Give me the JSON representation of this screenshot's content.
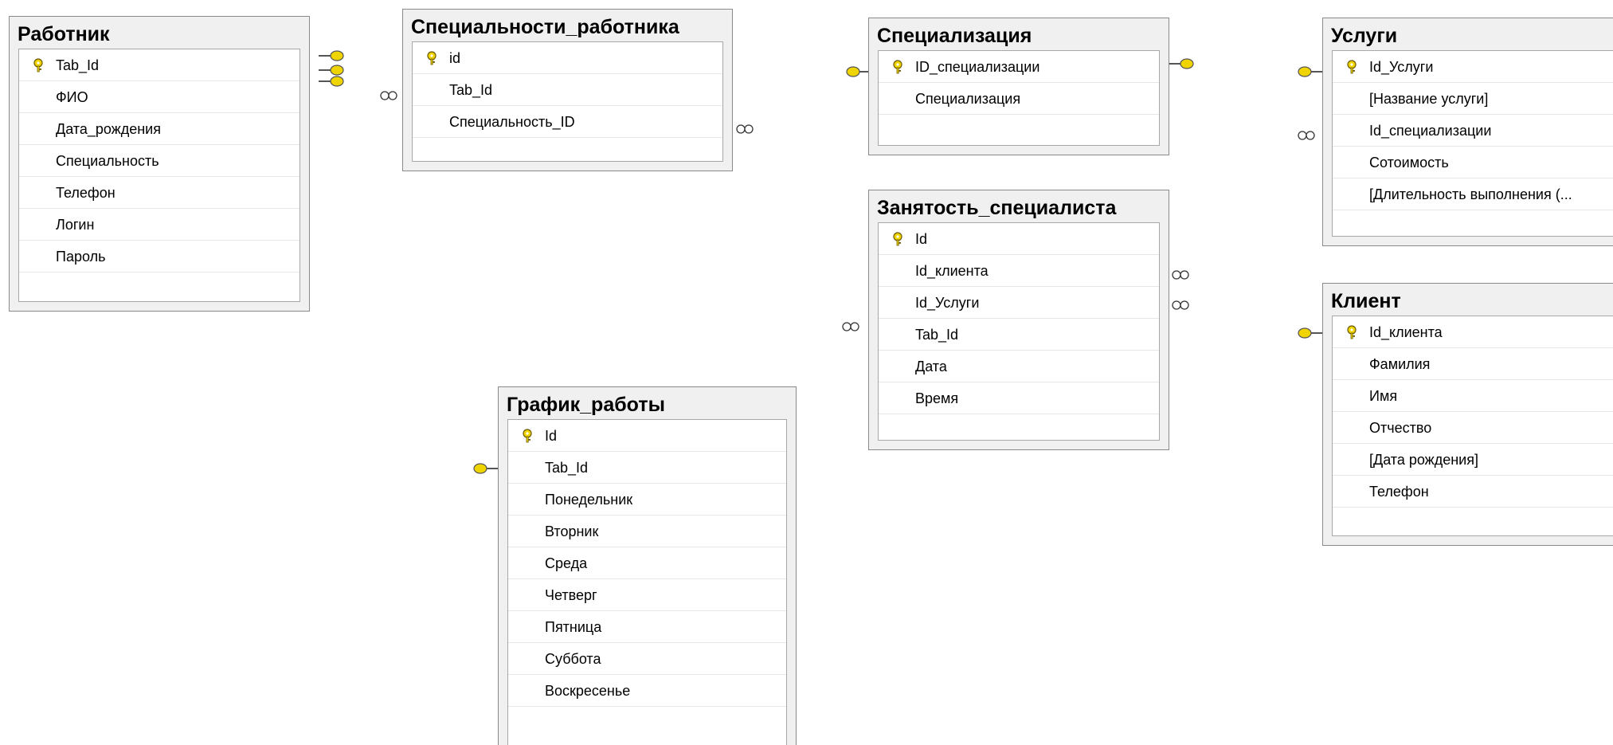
{
  "tables": {
    "worker": {
      "title": "Работник",
      "rows": [
        "Tab_Id",
        "ФИО",
        "Дата_рождения",
        "Специальность",
        "Телефон",
        "Логин",
        "Пароль"
      ]
    },
    "worker_specialties": {
      "title": "Специальности_работника",
      "rows": [
        "id",
        "Tab_Id",
        "Специальность_ID"
      ]
    },
    "specialization": {
      "title": "Специализация",
      "rows": [
        "ID_специализации",
        "Специализация"
      ]
    },
    "services": {
      "title": "Услуги",
      "rows": [
        "Id_Услуги",
        "[Название услуги]",
        "Id_специализации",
        "Сотоимость",
        "[Длительность выполнения (..."
      ]
    },
    "specialist_busy": {
      "title": "Занятость_специалиста",
      "rows": [
        "Id",
        "Id_клиента",
        "Id_Услуги",
        "Tab_Id",
        "Дата",
        "Время"
      ]
    },
    "client": {
      "title": "Клиент",
      "rows": [
        "Id_клиента",
        "Фамилия",
        "Имя",
        "Отчество",
        "[Дата рождения]",
        "Телефон"
      ]
    },
    "schedule": {
      "title": "График_работы",
      "rows": [
        "Id",
        "Tab_Id",
        "Понедельник",
        "Вторник",
        "Среда",
        "Четверг",
        "Пятница",
        "Суббота",
        "Воскресенье"
      ]
    }
  },
  "colors": {
    "key": "#f0d400",
    "connector": "#6f6f6f",
    "header_bg": "#f0f0f0"
  },
  "icons": {
    "primary_key": "key-icon",
    "one_end": "key-end-icon",
    "many_end": "infinity-icon"
  }
}
